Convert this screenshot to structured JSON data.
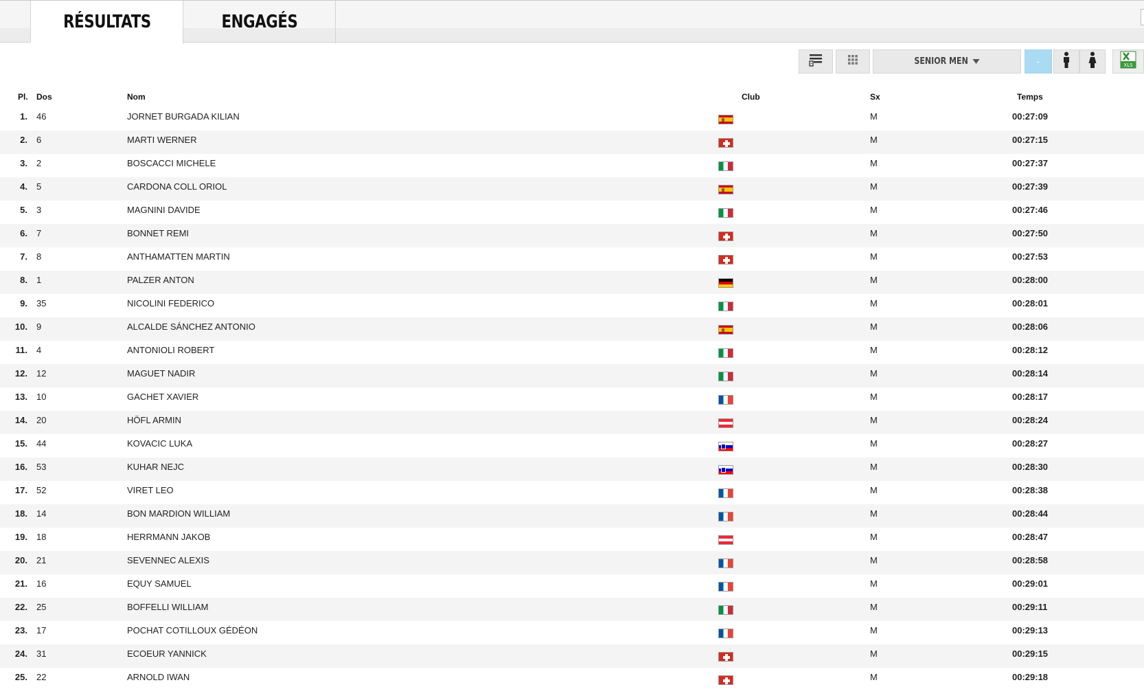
{
  "tabs": [
    {
      "label": "RÉSULTATS",
      "active": true
    },
    {
      "label": "ENGAGÉS",
      "active": false
    }
  ],
  "toolbar": {
    "list_view_icon": "list-view-icon",
    "grid_view_icon": "grid-view-icon",
    "category_select": "SENIOR MEN",
    "filter_all": "-",
    "male_icon": "male-icon",
    "female_icon": "female-icon",
    "excel_icon": "excel-xls-icon",
    "excel_label": "XLS"
  },
  "table": {
    "headers": {
      "pl": "Pl.",
      "dos": "Dos",
      "nom": "Nom",
      "club": "Club",
      "sx": "Sx",
      "temps": "Temps"
    },
    "rows": [
      {
        "pl": "1.",
        "dos": "46",
        "nom": "JORNET BURGADA KILIAN",
        "flag": "es",
        "sx": "M",
        "temps": "00:27:09"
      },
      {
        "pl": "2.",
        "dos": "6",
        "nom": "MARTI WERNER",
        "flag": "ch",
        "sx": "M",
        "temps": "00:27:15"
      },
      {
        "pl": "3.",
        "dos": "2",
        "nom": "BOSCACCI MICHELE",
        "flag": "it",
        "sx": "M",
        "temps": "00:27:37"
      },
      {
        "pl": "4.",
        "dos": "5",
        "nom": "CARDONA COLL ORIOL",
        "flag": "es",
        "sx": "M",
        "temps": "00:27:39"
      },
      {
        "pl": "5.",
        "dos": "3",
        "nom": "MAGNINI DAVIDE",
        "flag": "it",
        "sx": "M",
        "temps": "00:27:46"
      },
      {
        "pl": "6.",
        "dos": "7",
        "nom": "BONNET REMI",
        "flag": "ch",
        "sx": "M",
        "temps": "00:27:50"
      },
      {
        "pl": "7.",
        "dos": "8",
        "nom": "ANTHAMATTEN MARTIN",
        "flag": "ch",
        "sx": "M",
        "temps": "00:27:53"
      },
      {
        "pl": "8.",
        "dos": "1",
        "nom": "PALZER ANTON",
        "flag": "de",
        "sx": "M",
        "temps": "00:28:00"
      },
      {
        "pl": "9.",
        "dos": "35",
        "nom": "NICOLINI FEDERICO",
        "flag": "it",
        "sx": "M",
        "temps": "00:28:01"
      },
      {
        "pl": "10.",
        "dos": "9",
        "nom": "ALCALDE SÁNCHEZ ANTONIO",
        "flag": "es",
        "sx": "M",
        "temps": "00:28:06"
      },
      {
        "pl": "11.",
        "dos": "4",
        "nom": "ANTONIOLI ROBERT",
        "flag": "it",
        "sx": "M",
        "temps": "00:28:12"
      },
      {
        "pl": "12.",
        "dos": "12",
        "nom": "MAGUET NADIR",
        "flag": "it",
        "sx": "M",
        "temps": "00:28:14"
      },
      {
        "pl": "13.",
        "dos": "10",
        "nom": "GACHET XAVIER",
        "flag": "fr",
        "sx": "M",
        "temps": "00:28:17"
      },
      {
        "pl": "14.",
        "dos": "20",
        "nom": "HÖFL ARMIN",
        "flag": "at",
        "sx": "M",
        "temps": "00:28:24"
      },
      {
        "pl": "15.",
        "dos": "44",
        "nom": "KOVACIC LUKA",
        "flag": "si",
        "sx": "M",
        "temps": "00:28:27"
      },
      {
        "pl": "16.",
        "dos": "53",
        "nom": "KUHAR NEJC",
        "flag": "si",
        "sx": "M",
        "temps": "00:28:30"
      },
      {
        "pl": "17.",
        "dos": "52",
        "nom": "VIRET LEO",
        "flag": "fr",
        "sx": "M",
        "temps": "00:28:38"
      },
      {
        "pl": "18.",
        "dos": "14",
        "nom": "BON MARDION WILLIAM",
        "flag": "fr",
        "sx": "M",
        "temps": "00:28:44"
      },
      {
        "pl": "19.",
        "dos": "18",
        "nom": "HERRMANN JAKOB",
        "flag": "at",
        "sx": "M",
        "temps": "00:28:47"
      },
      {
        "pl": "20.",
        "dos": "21",
        "nom": "SEVENNEC ALEXIS",
        "flag": "fr",
        "sx": "M",
        "temps": "00:28:58"
      },
      {
        "pl": "21.",
        "dos": "16",
        "nom": "EQUY SAMUEL",
        "flag": "fr",
        "sx": "M",
        "temps": "00:29:01"
      },
      {
        "pl": "22.",
        "dos": "25",
        "nom": "BOFFELLI WILLIAM",
        "flag": "it",
        "sx": "M",
        "temps": "00:29:11"
      },
      {
        "pl": "23.",
        "dos": "17",
        "nom": "POCHAT COTILLOUX GÉDÉON",
        "flag": "fr",
        "sx": "M",
        "temps": "00:29:13"
      },
      {
        "pl": "24.",
        "dos": "31",
        "nom": "ECOEUR YANNICK",
        "flag": "ch",
        "sx": "M",
        "temps": "00:29:15"
      },
      {
        "pl": "25.",
        "dos": "22",
        "nom": "ARNOLD IWAN",
        "flag": "ch",
        "sx": "M",
        "temps": "00:29:18"
      }
    ]
  }
}
